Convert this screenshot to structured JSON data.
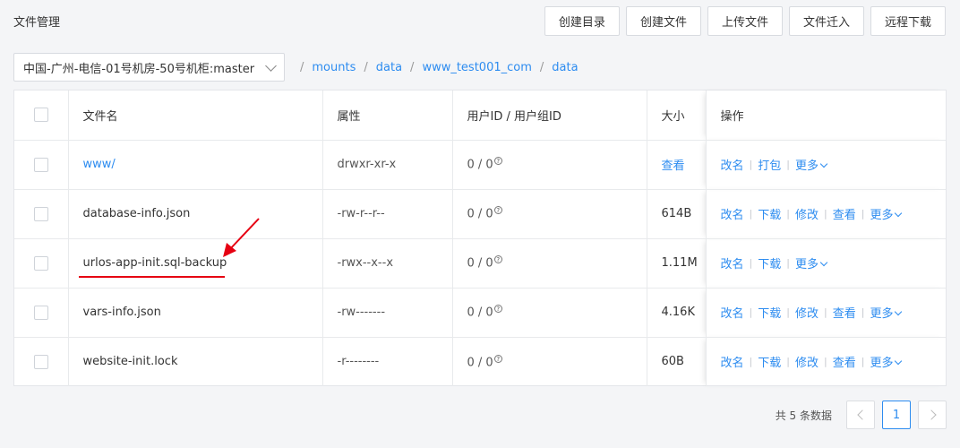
{
  "page_title": "文件管理",
  "toolbar": {
    "create_dir": "创建目录",
    "create_file": "创建文件",
    "upload_file": "上传文件",
    "import_file": "文件迁入",
    "remote_download": "远程下载"
  },
  "server_select": {
    "value": "中国-广州-电信-01号机房-50号机柜:master"
  },
  "breadcrumb": [
    "mounts",
    "data",
    "www_test001_com",
    "data"
  ],
  "table": {
    "headers": {
      "name": "文件名",
      "attr": "属性",
      "owner": "用户ID / 用户组ID",
      "size": "大小",
      "ops": "操作"
    },
    "rows": [
      {
        "name": "www/",
        "attr": "drwxr-xr-x",
        "owner": "0 / 0",
        "size": "查看",
        "ops": [
          "改名",
          "打包",
          "更多"
        ]
      },
      {
        "name": "database-info.json",
        "attr": "-rw-r--r--",
        "owner": "0 / 0",
        "size": "614B",
        "ops": [
          "改名",
          "下载",
          "修改",
          "查看",
          "更多"
        ]
      },
      {
        "name": "urlos-app-init.sql-backup",
        "attr": "-rwx--x--x",
        "owner": "0 / 0",
        "size": "1.11M",
        "ops": [
          "改名",
          "下载",
          "更多"
        ]
      },
      {
        "name": "vars-info.json",
        "attr": "-rw-------",
        "owner": "0 / 0",
        "size": "4.16K",
        "ops": [
          "改名",
          "下载",
          "修改",
          "查看",
          "更多"
        ]
      },
      {
        "name": "website-init.lock",
        "attr": "-r--------",
        "owner": "0 / 0",
        "size": "60B",
        "ops": [
          "改名",
          "下载",
          "修改",
          "查看",
          "更多"
        ]
      }
    ]
  },
  "help_mark": "?",
  "pagination": {
    "total_text": "共 5 条数据",
    "current_page": "1"
  },
  "colors": {
    "accent": "#2d8cf0",
    "annotation": "#e60012"
  }
}
